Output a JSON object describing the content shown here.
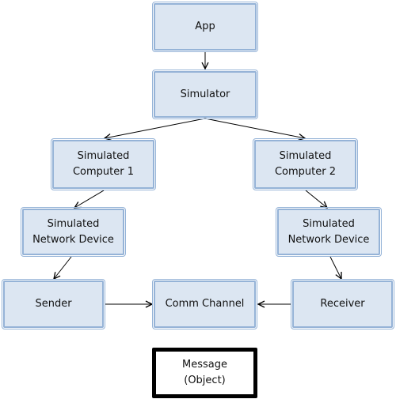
{
  "diagram": {
    "nodes": {
      "app": "App",
      "simulator": "Simulator",
      "computer1": "Simulated\nComputer 1",
      "computer2": "Simulated\nComputer 2",
      "netdev_left": "Simulated\nNetwork Device",
      "netdev_right": "Simulated\nNetwork Device",
      "sender": "Sender",
      "comm_channel": "Comm Channel",
      "receiver": "Receiver",
      "message": "Message\n(Object)"
    },
    "edges": [
      {
        "from": "app",
        "to": "simulator"
      },
      {
        "from": "simulator",
        "to": "computer1"
      },
      {
        "from": "simulator",
        "to": "computer2"
      },
      {
        "from": "computer1",
        "to": "netdev_left"
      },
      {
        "from": "computer2",
        "to": "netdev_right"
      },
      {
        "from": "netdev_left",
        "to": "sender"
      },
      {
        "from": "netdev_right",
        "to": "receiver"
      },
      {
        "from": "sender",
        "to": "comm_channel"
      },
      {
        "from": "receiver",
        "to": "comm_channel"
      }
    ],
    "colors": {
      "node_fill": "#dce6f2",
      "node_border": "#95b3d7",
      "arrow": "#000000"
    }
  }
}
